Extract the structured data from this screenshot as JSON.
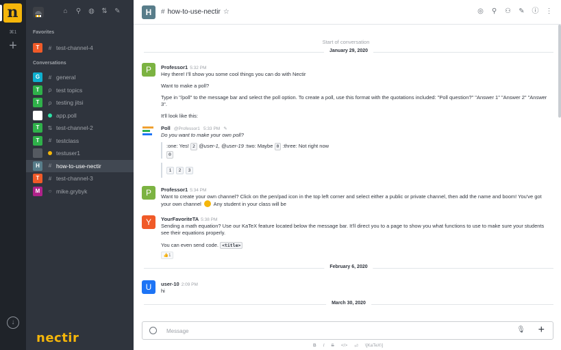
{
  "rail": {
    "logo_letter": "n",
    "shortcut": "⌘1"
  },
  "sidebar": {
    "favorites_title": "Favorites",
    "conversations_title": "Conversations",
    "favorites": [
      {
        "avatar": "T",
        "color": "#f05a28",
        "icon": "hash-icon",
        "glyph": "#",
        "name": "test-channel-4"
      }
    ],
    "items": [
      {
        "avatar": "G",
        "color": "#0eafcf",
        "icon": "hash-icon",
        "glyph": "#",
        "name": "general"
      },
      {
        "avatar": "T",
        "color": "#2fb14a",
        "icon": "discussion-icon",
        "glyph": "ρ",
        "name": "test topics"
      },
      {
        "avatar": "T",
        "color": "#2fb14a",
        "icon": "discussion-icon",
        "glyph": "ρ",
        "name": "testing jitsi"
      },
      {
        "avatar": "",
        "color": "#ffffff",
        "icon": "online-dot",
        "glyph": "",
        "dot": "#2de0a5",
        "name": "app.poll"
      },
      {
        "avatar": "T",
        "color": "#2fb14a",
        "icon": "team-icon",
        "glyph": "⇅",
        "name": "test-channel-2"
      },
      {
        "avatar": "T",
        "color": "#2fb14a",
        "icon": "hash-icon",
        "glyph": "#",
        "name": "testclass"
      },
      {
        "avatar": "",
        "color": "#555a61",
        "icon": "away-dot",
        "glyph": "",
        "dot": "#f5b60a",
        "name": "testuser1"
      },
      {
        "avatar": "H",
        "color": "#587d8a",
        "icon": "hash-icon",
        "glyph": "#",
        "name": "how-to-use-nectir",
        "active": true
      },
      {
        "avatar": "T",
        "color": "#f05a28",
        "icon": "hash-icon",
        "glyph": "#",
        "name": "test-channel-3"
      },
      {
        "avatar": "M",
        "color": "#b0228a",
        "icon": "offline-dot",
        "glyph": "○",
        "name": "mike.grybyk"
      }
    ],
    "brand": "nectir"
  },
  "header": {
    "avatar": "H",
    "hash": "#",
    "title": "how-to-use-nectir",
    "star": "☆"
  },
  "conversation": {
    "start_label": "Start of conversation",
    "date1": "January 29, 2020",
    "date2": "February 6, 2020",
    "date3": "March 30, 2020",
    "msg1": {
      "avatar": "P",
      "name": "Professor1",
      "time": "5:32 PM",
      "lines": [
        "Hey there! I'll show you some cool things you can do with Nectir",
        "Want to make a poll?",
        "Type in \"/poll\" to the message bar and select the poll option. To create a poll, use this format with the quotations included: \"Poll question?\" \"Answer 1\" \"Answer 2\" \"Answer 3\".",
        "It'll look like this:"
      ]
    },
    "poll": {
      "name": "Poll",
      "handle": "@Professor1",
      "time": "5:33 PM",
      "question": "Do you want to make your own poll?",
      "opt1": ":one: Yes!",
      "count1": "2",
      "voters1": "@user-1, @user-19",
      "opt2": ":two: Maybe",
      "count2": "0",
      "opt3": ":three: Not right now",
      "count3": "0",
      "buttons": [
        "1",
        "2",
        "3"
      ]
    },
    "msg2": {
      "avatar": "P",
      "name": "Professor1",
      "time": "5:34 PM",
      "text_a": "Want to create your own channel? Click on the pen/pad icon in the top left corner and select either a public or private channel, then add the name and boom! You've got your own channel",
      "text_b": "Any student in your class will be"
    },
    "msg3": {
      "avatar": "Y",
      "name": "YourFavoriteTA",
      "time": "5:38 PM",
      "text": "Sending a math equation? Use our KaTeX feature located below the message bar. It'll direct you to a page to show you what functions to use to make sure your students see their equations properly.",
      "code_intro": "You can even send code.",
      "code": "<title>",
      "reaction_count": "1"
    },
    "msg4": {
      "avatar": "U",
      "name": "user-10",
      "time": "2:09 PM",
      "text": "hi"
    }
  },
  "composer": {
    "placeholder": "Message",
    "formatting": [
      "B",
      "I",
      "S",
      "</>",
      "⏎",
      "\\[KaTeX\\]"
    ]
  },
  "colors": {
    "rail": "#1f2329",
    "sidebar": "#2f343d",
    "active": "#414852",
    "brand": "#f5b60a"
  }
}
